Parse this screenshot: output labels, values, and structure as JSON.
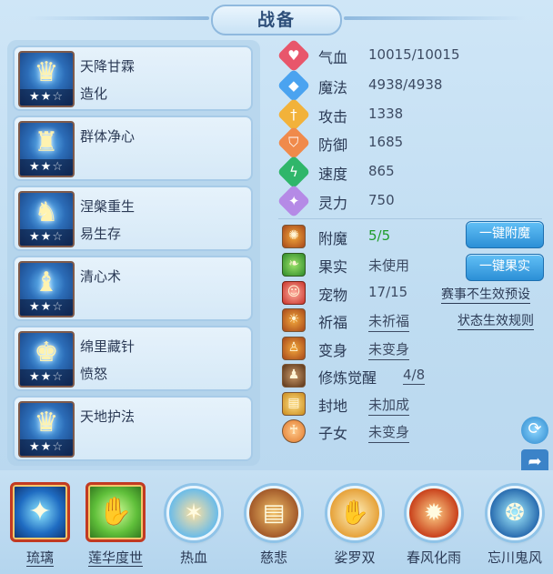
{
  "title": "战备",
  "skills": [
    {
      "name": "天降甘霖",
      "sub": "造化",
      "stars": "★★",
      "empty_stars": "☆",
      "icon": "helmet-gold-icon",
      "glyph": "♛"
    },
    {
      "name": "群体净心",
      "sub": "",
      "stars": "★★",
      "empty_stars": "☆",
      "icon": "helmet-blue-icon",
      "glyph": "♜"
    },
    {
      "name": "涅槃重生",
      "sub": "易生存",
      "stars": "★★",
      "empty_stars": "☆",
      "icon": "armor-icon",
      "glyph": "♞"
    },
    {
      "name": "清心术",
      "sub": "",
      "stars": "★★",
      "empty_stars": "☆",
      "icon": "helmet-icon",
      "glyph": "♝"
    },
    {
      "name": "绵里藏针",
      "sub": "愤怒",
      "stars": "★★",
      "empty_stars": "☆",
      "icon": "crown-icon",
      "glyph": "♚"
    },
    {
      "name": "天地护法",
      "sub": "",
      "stars": "★★",
      "empty_stars": "☆",
      "icon": "helmet-gold-blue-icon",
      "glyph": "♛"
    }
  ],
  "stats": [
    {
      "label": "气血",
      "value": "10015/10015",
      "icon": "heart-icon",
      "color": "#e8566b"
    },
    {
      "label": "魔法",
      "value": "4938/4938",
      "icon": "mana-icon",
      "color": "#4aa3f0"
    },
    {
      "label": "攻击",
      "value": "1338",
      "icon": "sword-icon",
      "color": "#f2b23a"
    },
    {
      "label": "防御",
      "value": "1685",
      "icon": "shield-icon",
      "color": "#f08a4b"
    },
    {
      "label": "速度",
      "value": "865",
      "icon": "lightning-icon",
      "color": "#2fb66a"
    },
    {
      "label": "灵力",
      "value": "750",
      "icon": "spirit-icon",
      "color": "#b58ae6"
    }
  ],
  "extras": [
    {
      "label": "附魔",
      "value": "5/5",
      "icon": "enchant-icon",
      "style": "green"
    },
    {
      "label": "果实",
      "value": "未使用",
      "icon": "fruit-icon",
      "style": "plain"
    },
    {
      "label": "宠物",
      "value": "17/15",
      "icon": "pet-icon",
      "style": "plain"
    },
    {
      "label": "祈福",
      "value": "未祈福",
      "icon": "blessing-icon",
      "style": "link"
    },
    {
      "label": "变身",
      "value": "未变身",
      "icon": "transform-icon",
      "style": "link"
    },
    {
      "label": "修炼觉醒",
      "value": "4/8",
      "icon": "cultivation-icon",
      "style": "link"
    },
    {
      "label": "封地",
      "value": "未加成",
      "icon": "fief-icon",
      "style": "link"
    },
    {
      "label": "子女",
      "value": "未变身",
      "icon": "child-icon",
      "style": "link"
    }
  ],
  "buttons": {
    "enchant": "一键附魔",
    "fruit": "一键果实"
  },
  "links": {
    "event_preset": "赛事不生效预设",
    "status_rules": "状态生效规则"
  },
  "bottom_slots": [
    {
      "label": "琉璃",
      "type": "square",
      "glyph": "✦",
      "icon": "glaze-icon"
    },
    {
      "label": "莲华度世",
      "type": "square",
      "glyph": "✋",
      "icon": "lotus-hand-icon"
    },
    {
      "label": "热血",
      "type": "round",
      "glyph": "✶",
      "icon": "hot-blood-icon"
    },
    {
      "label": "慈悲",
      "type": "round",
      "glyph": "▤",
      "icon": "mercy-icon"
    },
    {
      "label": "娑罗双",
      "type": "round",
      "glyph": "✋",
      "icon": "sal-tree-icon"
    },
    {
      "label": "春风化雨",
      "type": "round",
      "glyph": "✹",
      "icon": "spring-rain-icon"
    },
    {
      "label": "忘川鬼风",
      "type": "round",
      "glyph": "❂",
      "icon": "ghost-wind-icon"
    }
  ],
  "side_icons": [
    "refresh-icon",
    "share-icon"
  ]
}
